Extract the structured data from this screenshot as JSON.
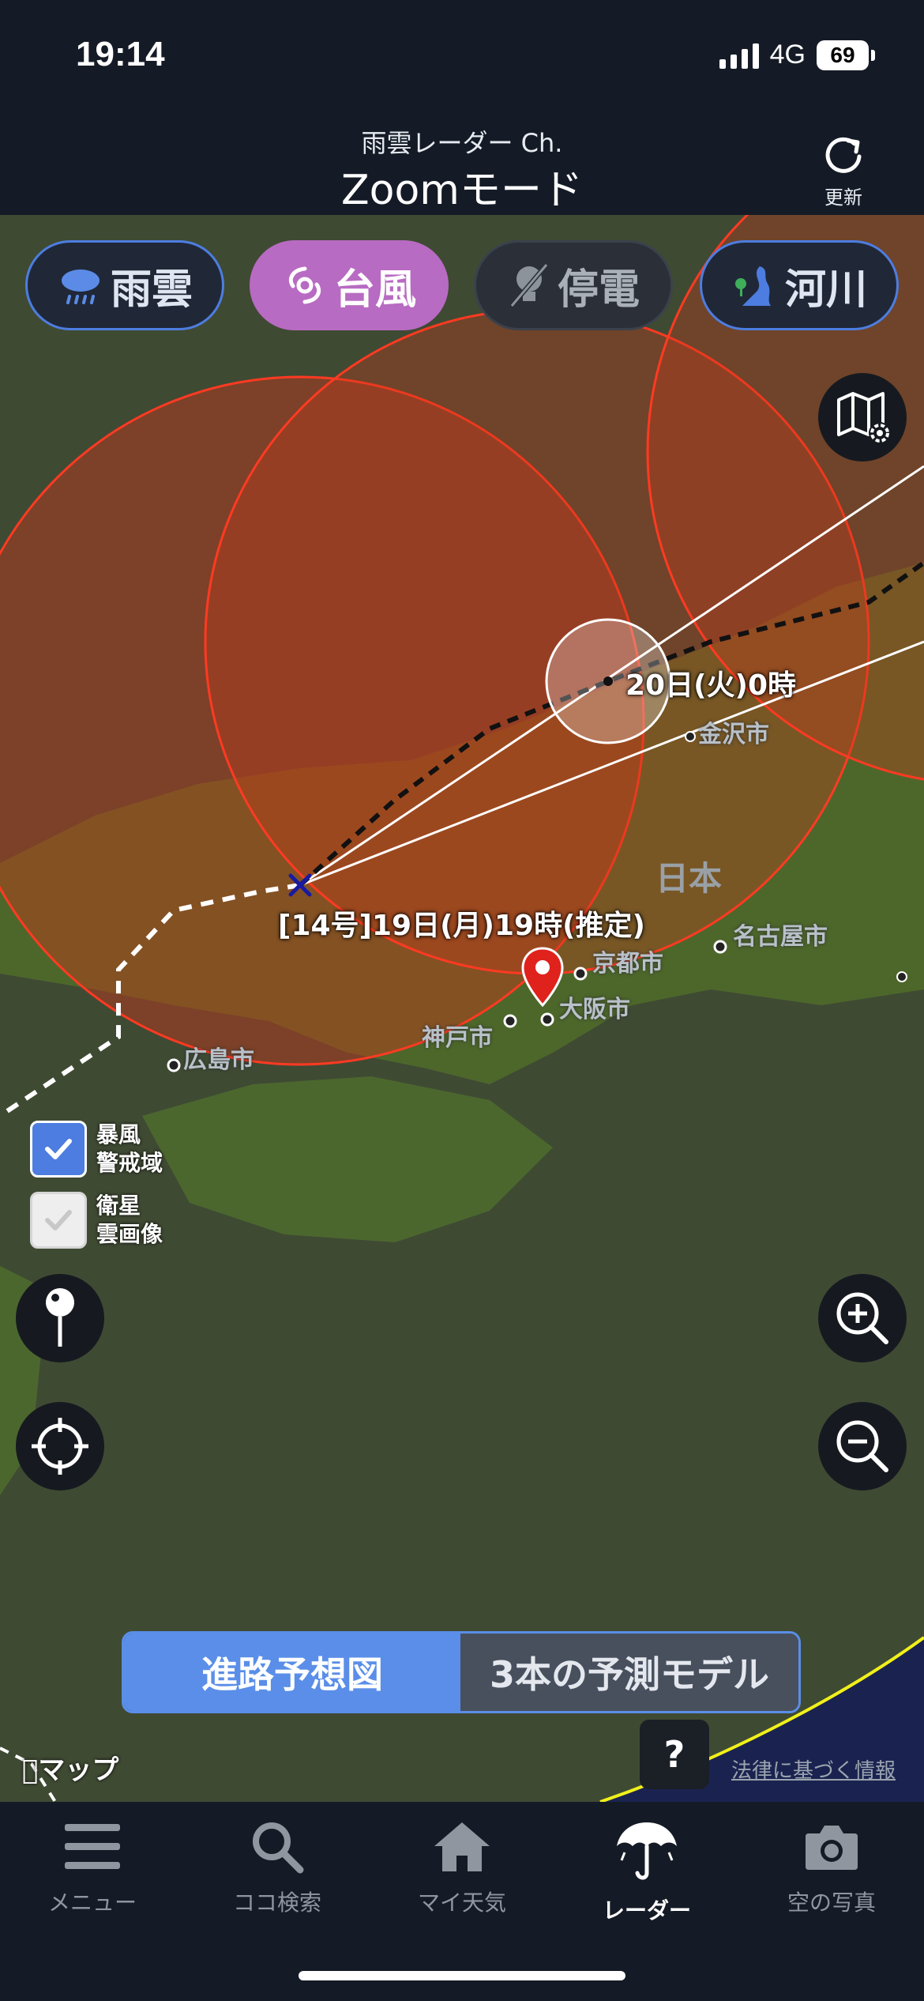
{
  "status": {
    "time": "19:14",
    "network": "4G",
    "battery": "69"
  },
  "header": {
    "subtitle": "雨雲レーダー Ch.",
    "title": "Zoomモード",
    "refresh_label": "更新"
  },
  "layers": [
    {
      "label": "雨雲",
      "icon": "rain-cloud-icon",
      "color": "#4d7de0"
    },
    {
      "label": "台風",
      "icon": "typhoon-icon",
      "color": "#b86bc2"
    },
    {
      "label": "停電",
      "icon": "power-outage-icon",
      "color": "#aab0b8"
    },
    {
      "label": "河川",
      "icon": "river-icon",
      "color": "#4d7de0"
    }
  ],
  "typhoon": {
    "current_label": "[14号]19日(月)19時(推定)",
    "forecast_label": "20日(火)0時",
    "storm_circle_color": "#e0402a",
    "track_color": "#ffffff"
  },
  "map_labels": {
    "country": "日本",
    "cities": [
      "金沢市",
      "名古屋市",
      "京都市",
      "大阪市",
      "神戸市",
      "広島市"
    ]
  },
  "toggles": [
    {
      "label_line1": "暴風",
      "label_line2": "警戒域",
      "checked": true
    },
    {
      "label_line1": "衛星",
      "label_line2": "雲画像",
      "checked": false
    }
  ],
  "segment": {
    "left": "進路予想図",
    "right": "3本の予測モデル",
    "selected": "left"
  },
  "help_label": "?",
  "apple_maps": "マップ",
  "legal_link": "法律に基づく情報",
  "tabs": [
    {
      "label": "メニュー",
      "icon": "menu-icon"
    },
    {
      "label": "ココ検索",
      "icon": "search-icon"
    },
    {
      "label": "マイ天気",
      "icon": "home-icon"
    },
    {
      "label": "レーダー",
      "icon": "umbrella-icon",
      "active": true
    },
    {
      "label": "空の写真",
      "icon": "camera-icon"
    }
  ]
}
